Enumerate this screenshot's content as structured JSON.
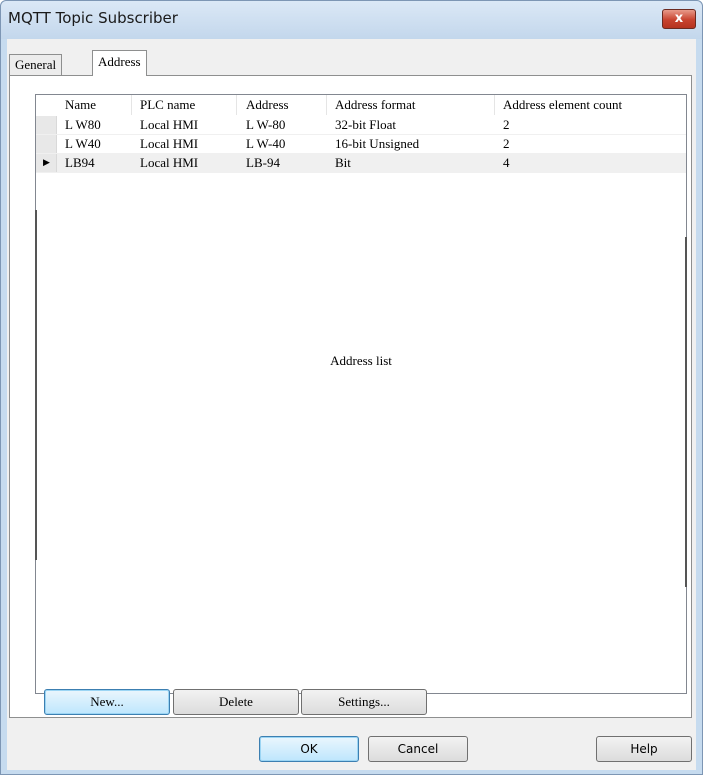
{
  "window": {
    "title": "MQTT Topic Subscriber",
    "close_glyph": "x"
  },
  "tabs": [
    {
      "label": "General",
      "selected": false
    },
    {
      "label": "Address",
      "selected": true
    }
  ],
  "grid": {
    "columns": [
      "Name",
      "PLC name",
      "Address",
      "Address format",
      "Address element count"
    ],
    "rows": [
      {
        "name": "L W80",
        "plc": "Local HMI",
        "address": "L W-80",
        "format": "32-bit Float",
        "count": "2"
      },
      {
        "name": "L W40",
        "plc": "Local HMI",
        "address": "L W-40",
        "format": "16-bit Unsigned",
        "count": "2"
      },
      {
        "name": "LB94",
        "plc": "Local HMI",
        "address": "LB-94",
        "format": "Bit",
        "count": "4",
        "current": true
      }
    ],
    "empty_label": "Address list",
    "row_indicator_glyph": "▶"
  },
  "list_buttons": {
    "new": "New...",
    "delete": "Delete",
    "settings": "Settings..."
  },
  "dialog_buttons": {
    "ok": "OK",
    "cancel": "Cancel",
    "help": "Help"
  }
}
